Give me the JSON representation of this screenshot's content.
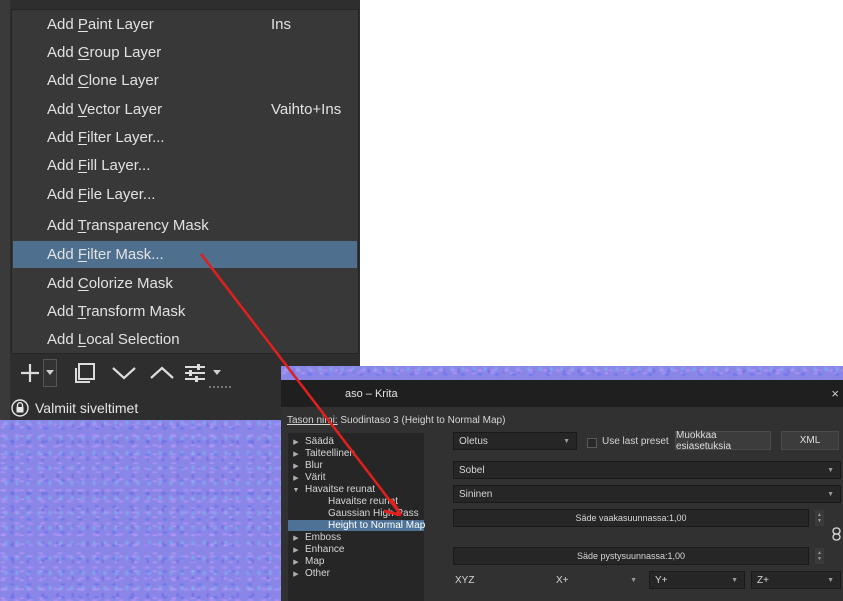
{
  "menu": {
    "items": [
      {
        "pre": "Add ",
        "key": "P",
        "post": "aint Layer",
        "shortcut": "Ins"
      },
      {
        "pre": "Add ",
        "key": "G",
        "post": "roup Layer",
        "shortcut": ""
      },
      {
        "pre": "Add ",
        "key": "C",
        "post": "lone Layer",
        "shortcut": ""
      },
      {
        "pre": "Add ",
        "key": "V",
        "post": "ector Layer",
        "shortcut": "Vaihto+Ins"
      },
      {
        "pre": "Add ",
        "key": "F",
        "post": "ilter Layer...",
        "shortcut": ""
      },
      {
        "pre": "Add ",
        "key": "F",
        "post": "ill Layer...",
        "shortcut": ""
      },
      {
        "pre": "Add ",
        "key": "F",
        "post": "ile Layer...",
        "shortcut": ""
      },
      {
        "pre": "Add ",
        "key": "T",
        "post": "ransparency Mask",
        "shortcut": ""
      },
      {
        "pre": "Add ",
        "key": "F",
        "post": "ilter Mask...",
        "shortcut": ""
      },
      {
        "pre": "Add ",
        "key": "C",
        "post": "olorize Mask",
        "shortcut": ""
      },
      {
        "pre": "Add ",
        "key": "T",
        "post": "ransform Mask",
        "shortcut": ""
      },
      {
        "pre": "Add ",
        "key": "L",
        "post": "ocal Selection",
        "shortcut": ""
      }
    ],
    "selected_index": 8
  },
  "toolbar": {
    "icons": [
      "plus-icon",
      "duplicate-icon",
      "move-down-icon",
      "move-up-icon",
      "properties-icon"
    ]
  },
  "brushes": {
    "label": "Valmiit siveltimet"
  },
  "dialog": {
    "title": "aso – Krita",
    "close": "×",
    "layer_name_label": "Tason nimi:",
    "layer_name_value": "Suodintaso 3 (Height to Normal Map)",
    "tree": [
      {
        "label": "Säädä",
        "level": 0,
        "arrow": "right"
      },
      {
        "label": "Taiteellinen",
        "level": 0,
        "arrow": "right"
      },
      {
        "label": "Blur",
        "level": 0,
        "arrow": "right"
      },
      {
        "label": "Värit",
        "level": 0,
        "arrow": "right"
      },
      {
        "label": "Havaitse reunat",
        "level": 0,
        "arrow": "down"
      },
      {
        "label": "Havaitse reunat",
        "level": 1,
        "arrow": ""
      },
      {
        "label": "Gaussian High Pass",
        "level": 1,
        "arrow": ""
      },
      {
        "label": "Height to Normal Map",
        "level": 1,
        "arrow": ""
      },
      {
        "label": "Emboss",
        "level": 0,
        "arrow": "right"
      },
      {
        "label": "Enhance",
        "level": 0,
        "arrow": "right"
      },
      {
        "label": "Map",
        "level": 0,
        "arrow": "right"
      },
      {
        "label": "Other",
        "level": 0,
        "arrow": "right"
      }
    ],
    "tree_selected_index": 7,
    "preset": "Oletus",
    "use_last_preset_label": "Use last preset",
    "edit_presets_label": "Muokkaa esiasetuksia",
    "xml_label": "XML",
    "method": "Sobel",
    "channel": "Sininen",
    "horizontal_radius": "Säde vaakasuunnassa:1,00",
    "vertical_radius": "Säde pystysuunnassa:1,00",
    "xyz_label": "XYZ",
    "x_value": "X+",
    "y_value": "Y+",
    "z_value": "Z+"
  },
  "colors": {
    "menu_bg": "#383838",
    "selection": "#4e6f8e",
    "arrow": "#e0201c",
    "dialog_bg": "#313131"
  }
}
